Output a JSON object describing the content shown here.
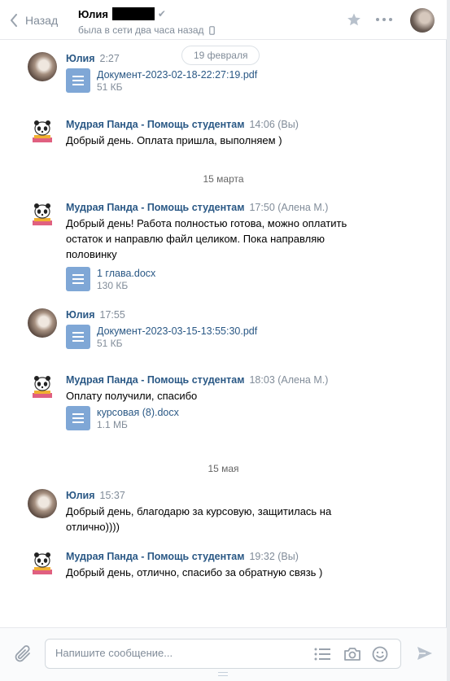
{
  "header": {
    "back_label": "Назад",
    "contact_name": "Юлия",
    "status": "была в сети два часа назад",
    "verified_mark": "✔"
  },
  "dates": [
    "19 февраля",
    "15 марта",
    "15 мая"
  ],
  "messages": [
    {
      "author": "Юлия",
      "time": "2:27",
      "note": "",
      "text": "",
      "doc": {
        "name": "Документ-2023-02-18-22:27:19.pdf",
        "size": "51 КБ"
      }
    },
    {
      "author": "Мудрая Панда - Помощь студентам",
      "time": "14:06",
      "note": "(Вы)",
      "text": "Добрый день. Оплата пришла, выполняем )"
    },
    {
      "author": "Мудрая Панда - Помощь студентам",
      "time": "17:50",
      "note": "(Алена М.)",
      "text_lines": [
        "Добрый день! Работа полностью готова, можно оплатить",
        "остаток и направлю файл целиком. Пока направляю",
        "половинку"
      ],
      "doc": {
        "name": "1 глава.docx",
        "size": "130 КБ"
      }
    },
    {
      "author": "Юлия",
      "time": "17:55",
      "note": "",
      "doc": {
        "name": "Документ-2023-03-15-13:55:30.pdf",
        "size": "51 КБ"
      }
    },
    {
      "author": "Мудрая Панда - Помощь студентам",
      "time": "18:03",
      "note": "(Алена М.)",
      "text": "Оплату получили, спасибо",
      "doc": {
        "name": "курсовая (8).docx",
        "size": "1.1 МБ"
      }
    },
    {
      "author": "Юлия",
      "time": "15:37",
      "note": "",
      "text_lines": [
        "Добрый день, благодарю за курсовую, защитилась на",
        "отлично))))"
      ]
    },
    {
      "author": "Мудрая Панда - Помощь студентам",
      "time": "19:32",
      "note": "(Вы)",
      "text": "Добрый день, отлично, спасибо за обратную связь )"
    }
  ],
  "composer": {
    "placeholder": "Напишите сообщение..."
  },
  "colors": {
    "link": "#2a5885",
    "muted": "#818c99",
    "doc_icon": "#7fa7d6"
  },
  "icons": [
    "chevron-left-icon",
    "star-icon",
    "more-icon",
    "phone-icon",
    "document-icon",
    "paperclip-icon",
    "list-icon",
    "camera-icon",
    "smile-icon",
    "send-icon"
  ]
}
